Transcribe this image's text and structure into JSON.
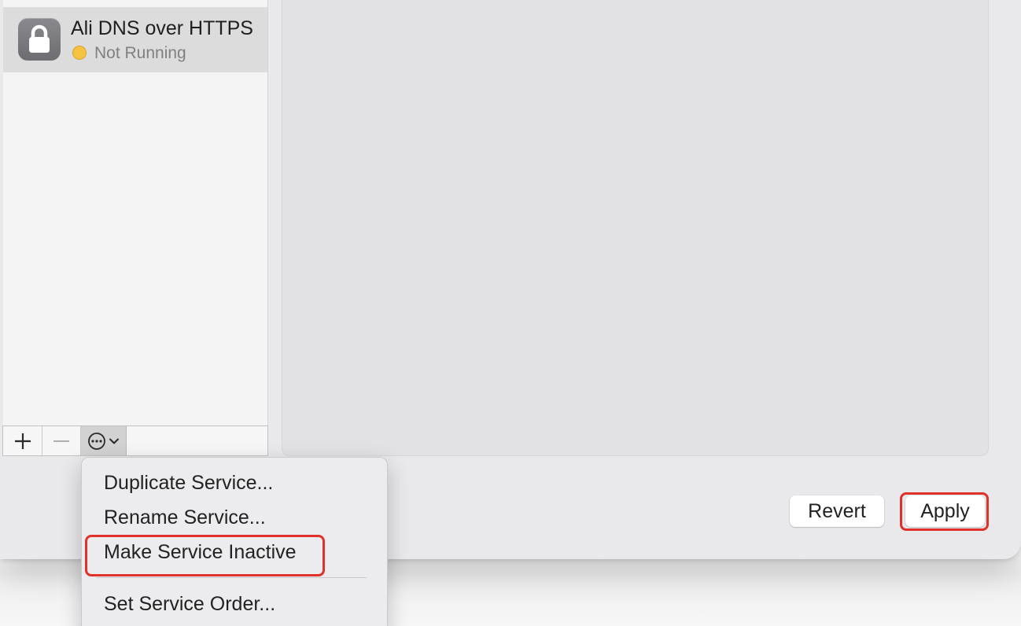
{
  "services": [
    {
      "name": "Ali DNS over HTTPS",
      "status": "Not Running",
      "status_color": "#f5c242",
      "icon": "lock-icon",
      "selected": true
    }
  ],
  "list_toolbar": {
    "add_icon": "plus-icon",
    "remove_icon": "minus-icon",
    "action_icon": "ellipsis-circle-icon",
    "chevron_icon": "chevron-down-icon"
  },
  "action_menu": {
    "items": [
      {
        "label": "Duplicate Service..."
      },
      {
        "label": "Rename Service..."
      },
      {
        "label": "Make Service Inactive",
        "highlighted": true
      },
      {
        "label": "Set Service Order..."
      }
    ]
  },
  "footer_buttons": {
    "revert_label": "Revert",
    "apply_label": "Apply",
    "apply_highlighted": true
  },
  "colors": {
    "highlight": "#e0312a",
    "window_bg": "#e9e8eb"
  }
}
